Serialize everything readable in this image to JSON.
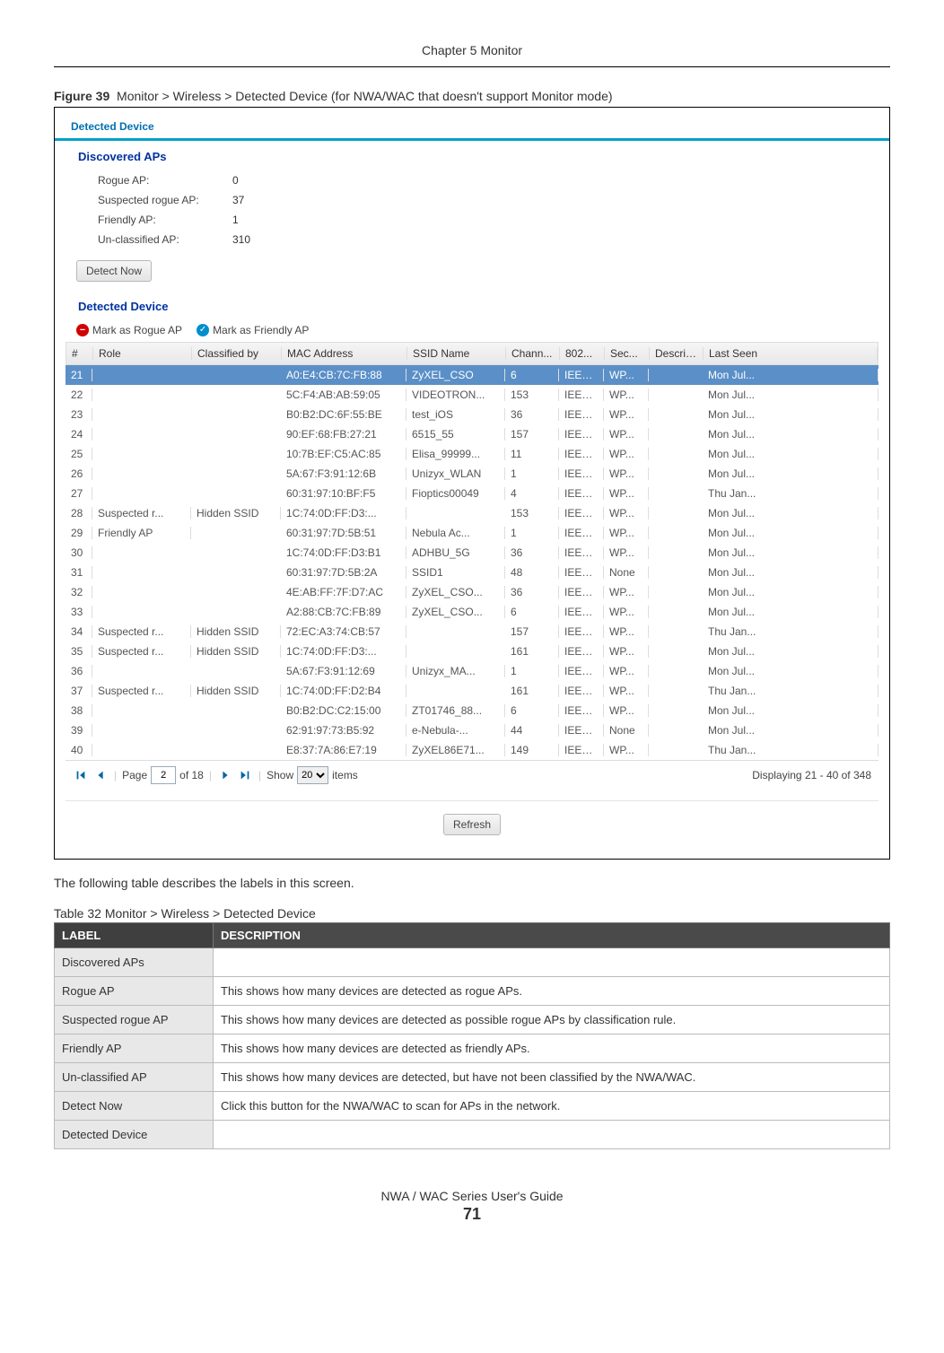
{
  "chapter_header": "Chapter 5 Monitor",
  "figure": {
    "label": "Figure 39",
    "text": "Monitor > Wireless > Detected Device (for NWA/WAC that doesn't support Monitor mode)"
  },
  "screenshot": {
    "tab": "Detected Device",
    "discovered_title": "Discovered APs",
    "stats": {
      "rogue_label": "Rogue AP:",
      "rogue_value": "0",
      "suspected_label": "Suspected rogue AP:",
      "suspected_value": "37",
      "friendly_label": "Friendly AP:",
      "friendly_value": "1",
      "unclassified_label": "Un-classified AP:",
      "unclassified_value": "310"
    },
    "detect_now": "Detect Now",
    "detected_title": "Detected Device",
    "toolbar": {
      "mark_rogue": "Mark as Rogue AP",
      "mark_friendly": "Mark as Friendly AP"
    },
    "columns": [
      "#",
      "Role",
      "Classified by",
      "MAC Address",
      "SSID Name",
      "Chann...",
      "802...",
      "Sec...",
      "Descrip...",
      "Last Seen"
    ],
    "rows": [
      {
        "num": "21",
        "role": "",
        "cls": "",
        "mac": "A0:E4:CB:7C:FB:88",
        "ssid": "ZyXEL_CSO",
        "ch": "6",
        "p": "IEEE...",
        "sec": "WP...",
        "d": "",
        "seen": "Mon Jul...",
        "sel": true
      },
      {
        "num": "22",
        "role": "",
        "cls": "",
        "mac": "5C:F4:AB:AB:59:05",
        "ssid": "VIDEOTRON...",
        "ch": "153",
        "p": "IEEE...",
        "sec": "WP...",
        "d": "",
        "seen": "Mon Jul..."
      },
      {
        "num": "23",
        "role": "",
        "cls": "",
        "mac": "B0:B2:DC:6F:55:BE",
        "ssid": "test_iOS",
        "ch": "36",
        "p": "IEEE...",
        "sec": "WP...",
        "d": "",
        "seen": "Mon Jul..."
      },
      {
        "num": "24",
        "role": "",
        "cls": "",
        "mac": "90:EF:68:FB:27:21",
        "ssid": "6515_55",
        "ch": "157",
        "p": "IEEE...",
        "sec": "WP...",
        "d": "",
        "seen": "Mon Jul..."
      },
      {
        "num": "25",
        "role": "",
        "cls": "",
        "mac": "10:7B:EF:C5:AC:85",
        "ssid": "Elisa_99999...",
        "ch": "11",
        "p": "IEEE...",
        "sec": "WP...",
        "d": "",
        "seen": "Mon Jul..."
      },
      {
        "num": "26",
        "role": "",
        "cls": "",
        "mac": "5A:67:F3:91:12:6B",
        "ssid": "Unizyx_WLAN",
        "ch": "1",
        "p": "IEEE...",
        "sec": "WP...",
        "d": "",
        "seen": "Mon Jul..."
      },
      {
        "num": "27",
        "role": "",
        "cls": "",
        "mac": "60:31:97:10:BF:F5",
        "ssid": "Fioptics00049",
        "ch": "4",
        "p": "IEEE...",
        "sec": "WP...",
        "d": "",
        "seen": "Thu Jan..."
      },
      {
        "num": "28",
        "role": "Suspected r...",
        "cls": "Hidden SSID",
        "mac": "1C:74:0D:FF:D3:...",
        "ssid": "",
        "ch": "153",
        "p": "IEEE...",
        "sec": "WP...",
        "d": "",
        "seen": "Mon Jul..."
      },
      {
        "num": "29",
        "role": "Friendly AP",
        "cls": "",
        "mac": "60:31:97:7D:5B:51",
        "ssid": "Nebula Ac...",
        "ch": "1",
        "p": "IEEE...",
        "sec": "WP...",
        "d": "",
        "seen": "Mon Jul..."
      },
      {
        "num": "30",
        "role": "",
        "cls": "",
        "mac": "1C:74:0D:FF:D3:B1",
        "ssid": "ADHBU_5G",
        "ch": "36",
        "p": "IEEE...",
        "sec": "WP...",
        "d": "",
        "seen": "Mon Jul..."
      },
      {
        "num": "31",
        "role": "",
        "cls": "",
        "mac": "60:31:97:7D:5B:2A",
        "ssid": "SSID1",
        "ch": "48",
        "p": "IEEE...",
        "sec": "None",
        "d": "",
        "seen": "Mon Jul..."
      },
      {
        "num": "32",
        "role": "",
        "cls": "",
        "mac": "4E:AB:FF:7F:D7:AC",
        "ssid": "ZyXEL_CSO...",
        "ch": "36",
        "p": "IEEE...",
        "sec": "WP...",
        "d": "",
        "seen": "Mon Jul..."
      },
      {
        "num": "33",
        "role": "",
        "cls": "",
        "mac": "A2:88:CB:7C:FB:89",
        "ssid": "ZyXEL_CSO...",
        "ch": "6",
        "p": "IEEE...",
        "sec": "WP...",
        "d": "",
        "seen": "Mon Jul..."
      },
      {
        "num": "34",
        "role": "Suspected r...",
        "cls": "Hidden SSID",
        "mac": "72:EC:A3:74:CB:57",
        "ssid": "",
        "ch": "157",
        "p": "IEEE...",
        "sec": "WP...",
        "d": "",
        "seen": "Thu Jan..."
      },
      {
        "num": "35",
        "role": "Suspected r...",
        "cls": "Hidden SSID",
        "mac": "1C:74:0D:FF:D3:...",
        "ssid": "",
        "ch": "161",
        "p": "IEEE...",
        "sec": "WP...",
        "d": "",
        "seen": "Mon Jul..."
      },
      {
        "num": "36",
        "role": "",
        "cls": "",
        "mac": "5A:67:F3:91:12:69",
        "ssid": "Unizyx_MA...",
        "ch": "1",
        "p": "IEEE...",
        "sec": "WP...",
        "d": "",
        "seen": "Mon Jul..."
      },
      {
        "num": "37",
        "role": "Suspected r...",
        "cls": "Hidden SSID",
        "mac": "1C:74:0D:FF:D2:B4",
        "ssid": "",
        "ch": "161",
        "p": "IEEE...",
        "sec": "WP...",
        "d": "",
        "seen": "Thu Jan..."
      },
      {
        "num": "38",
        "role": "",
        "cls": "",
        "mac": "B0:B2:DC:C2:15:00",
        "ssid": "ZT01746_88...",
        "ch": "6",
        "p": "IEEE...",
        "sec": "WP...",
        "d": "",
        "seen": "Mon Jul..."
      },
      {
        "num": "39",
        "role": "",
        "cls": "",
        "mac": "62:91:97:73:B5:92",
        "ssid": "e-Nebula-...",
        "ch": "44",
        "p": "IEEE...",
        "sec": "None",
        "d": "",
        "seen": "Mon Jul..."
      },
      {
        "num": "40",
        "role": "",
        "cls": "",
        "mac": "E8:37:7A:86:E7:19",
        "ssid": "ZyXEL86E71...",
        "ch": "149",
        "p": "IEEE...",
        "sec": "WP...",
        "d": "",
        "seen": "Thu Jan..."
      }
    ],
    "pager": {
      "page_label": "Page",
      "page_value": "2",
      "of_label": "of 18",
      "show_label": "Show",
      "show_value": "20",
      "items_label": "items",
      "display": "Displaying 21 - 40 of 348"
    },
    "refresh": "Refresh"
  },
  "after_para": "The following table describes the labels in this screen.",
  "table_caption": "Table 32   Monitor > Wireless > Detected Device",
  "desc_headers": {
    "label": "LABEL",
    "desc": "DESCRIPTION"
  },
  "desc_rows": [
    {
      "label": "Discovered APs",
      "desc": ""
    },
    {
      "label": "Rogue AP",
      "desc": "This shows how many devices are detected as rogue APs."
    },
    {
      "label": "Suspected rogue AP",
      "desc": "This shows how many devices are detected as possible rogue APs by classification rule."
    },
    {
      "label": "Friendly AP",
      "desc": "This shows how many devices are detected as friendly APs."
    },
    {
      "label": "Un-classified AP",
      "desc": "This shows how many devices are detected, but have not been classified by the NWA/WAC."
    },
    {
      "label": "Detect Now",
      "desc": "Click this button for the NWA/WAC to scan for APs in the network."
    },
    {
      "label": "Detected Device",
      "desc": ""
    }
  ],
  "footer": {
    "guide": "NWA / WAC Series User's Guide",
    "page": "71"
  }
}
